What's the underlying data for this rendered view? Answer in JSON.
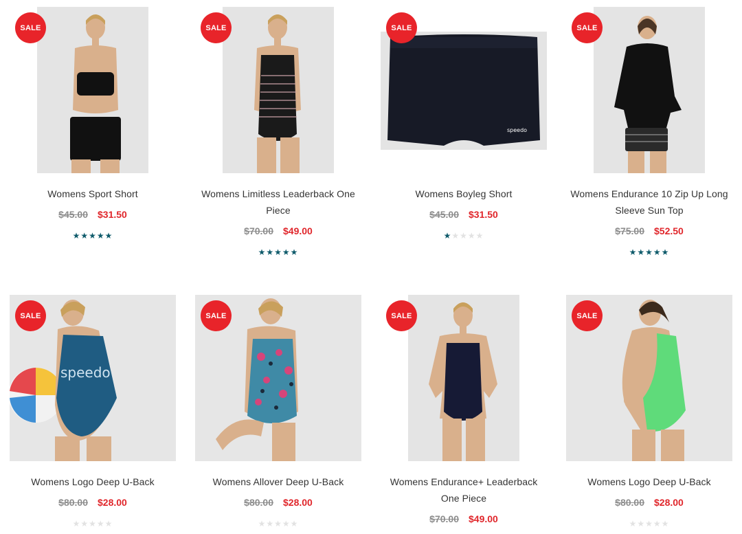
{
  "products": [
    {
      "title": "Womens Sport Short",
      "old_price": "$45.00",
      "new_price": "$31.50",
      "badge": "SALE",
      "rating": 5
    },
    {
      "title": "Womens Limitless Leaderback One Piece",
      "old_price": "$70.00",
      "new_price": "$49.00",
      "badge": "SALE",
      "rating": 5
    },
    {
      "title": "Womens Boyleg Short",
      "old_price": "$45.00",
      "new_price": "$31.50",
      "badge": "SALE",
      "rating": 1
    },
    {
      "title": "Womens Endurance 10 Zip Up Long Sleeve Sun Top",
      "old_price": "$75.00",
      "new_price": "$52.50",
      "badge": "SALE",
      "rating": 5
    },
    {
      "title": "Womens Logo Deep U-Back",
      "old_price": "$80.00",
      "new_price": "$28.00",
      "badge": "SALE",
      "rating": 0
    },
    {
      "title": "Womens Allover Deep U-Back",
      "old_price": "$80.00",
      "new_price": "$28.00",
      "badge": "SALE",
      "rating": 0
    },
    {
      "title": "Womens Endurance+ Leaderback One Piece",
      "old_price": "$70.00",
      "new_price": "$49.00",
      "badge": "SALE",
      "rating": 0
    },
    {
      "title": "Womens Logo Deep U-Back",
      "old_price": "$80.00",
      "new_price": "$28.00",
      "badge": "SALE",
      "rating": 0
    }
  ],
  "colors": {
    "sale_badge": "#e8242a",
    "sale_price": "#e0262b",
    "old_price": "#8d8d8d",
    "star_filled": "#0f5b6b",
    "star_empty": "#e2e2e2"
  }
}
